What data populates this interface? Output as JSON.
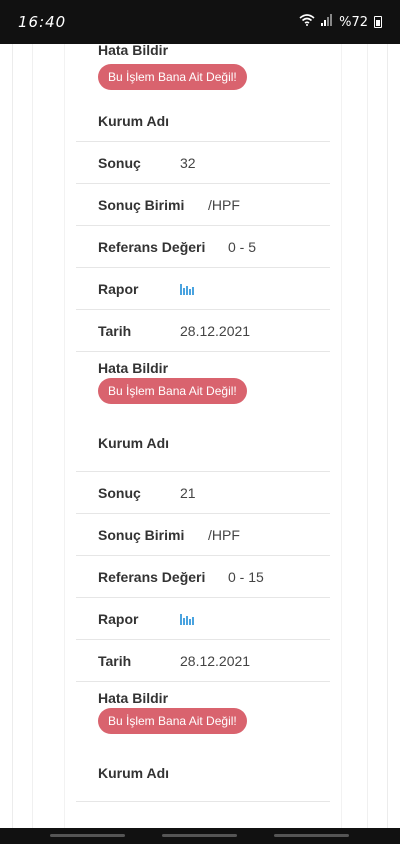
{
  "status": {
    "time": "16:40",
    "battery": "%72"
  },
  "colors": {
    "accent_button": "#d9636e",
    "chart_icon": "#4aa3df"
  },
  "records": [
    {
      "hata_bildir": "Hata Bildir",
      "report_button": "Bu İşlem Bana Ait Değil!",
      "kurum_label": "Kurum Adı"
    },
    {
      "sonuc_label": "Sonuç",
      "sonuc": "32",
      "birim_label": "Sonuç Birimi",
      "birim": "/HPF",
      "referans_label": "Referans Değeri",
      "referans": "0 - 5",
      "rapor_label": "Rapor",
      "tarih_label": "Tarih",
      "tarih": "28.12.2021",
      "hata_bildir": "Hata Bildir",
      "report_button": "Bu İşlem Bana Ait Değil!",
      "kurum_label": "Kurum Adı"
    },
    {
      "sonuc_label": "Sonuç",
      "sonuc": "21",
      "birim_label": "Sonuç Birimi",
      "birim": "/HPF",
      "referans_label": "Referans Değeri",
      "referans": "0 - 15",
      "rapor_label": "Rapor",
      "tarih_label": "Tarih",
      "tarih": "28.12.2021",
      "hata_bildir": "Hata Bildir",
      "report_button": "Bu İşlem Bana Ait Değil!",
      "kurum_label": "Kurum Adı"
    }
  ]
}
